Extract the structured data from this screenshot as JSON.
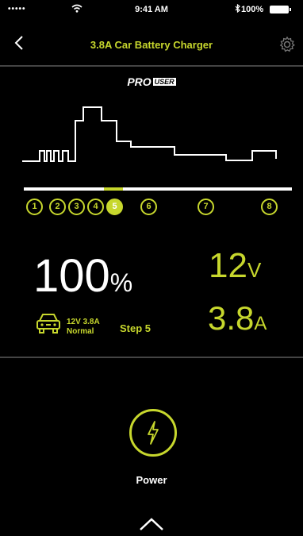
{
  "status_bar": {
    "signal": "•••••",
    "time": "9:41 AM",
    "battery_text": "100%"
  },
  "nav": {
    "title": "3.8A Car Battery Charger",
    "back_icon": "chevron-left-icon",
    "settings_icon": "gear-icon"
  },
  "logo": {
    "pro": "PRO",
    "user": "USER"
  },
  "steps": {
    "labels": [
      "1",
      "2",
      "3",
      "4",
      "5",
      "6",
      "7",
      "8"
    ],
    "active": "5"
  },
  "metrics": {
    "percent_value": "100",
    "percent_unit": "%",
    "voltage_value": "12",
    "voltage_unit": "V",
    "current_value": "3.8",
    "current_unit": "A",
    "mode_line1": "12V 3.8A",
    "mode_line2": "Normal",
    "step_text": "Step 5"
  },
  "power": {
    "label": "Power",
    "icon": "lightning-icon"
  },
  "colors": {
    "accent": "#c7d72d",
    "background": "#000000",
    "text": "#ffffff"
  }
}
